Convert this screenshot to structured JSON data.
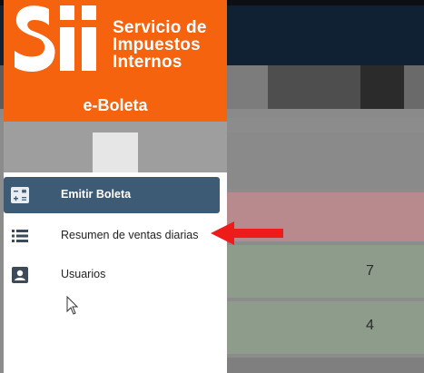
{
  "brand": {
    "logo_text": "Sii",
    "name_lines": [
      "Servicio de",
      "Impuestos",
      "Internos"
    ],
    "app_title": "e-Boleta"
  },
  "menu": {
    "items": [
      {
        "label": "Emitir Boleta",
        "icon": "calculator-icon",
        "active": true
      },
      {
        "label": "Resumen de ventas diarias",
        "icon": "list-icon",
        "active": false
      },
      {
        "label": "Usuarios",
        "icon": "account-box-icon",
        "active": false
      }
    ]
  },
  "background": {
    "values": [
      "7",
      "4"
    ]
  },
  "colors": {
    "brand_orange": "#f5630f",
    "active_item": "#3e5b75",
    "topbar": "#0f2133",
    "highlight_arrow": "#ee1b1b",
    "row_red": "#b88a8e",
    "row_green": "#8e9c8c"
  }
}
